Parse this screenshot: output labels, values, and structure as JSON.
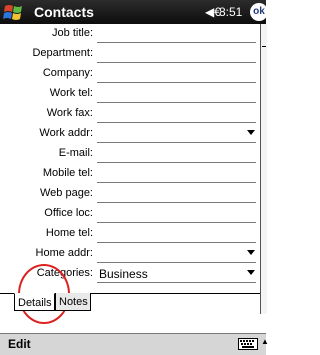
{
  "window": {
    "title": "Contacts",
    "time": "8:51",
    "ok_label": "ok",
    "speaker_glyph": "◀€"
  },
  "fields": [
    {
      "label": "Job title:",
      "value": "",
      "dropdown": false
    },
    {
      "label": "Department:",
      "value": "",
      "dropdown": false
    },
    {
      "label": "Company:",
      "value": "",
      "dropdown": false
    },
    {
      "label": "Work tel:",
      "value": "",
      "dropdown": false
    },
    {
      "label": "Work fax:",
      "value": "",
      "dropdown": false
    },
    {
      "label": "Work addr:",
      "value": "",
      "dropdown": true
    },
    {
      "label": "E-mail:",
      "value": "",
      "dropdown": false
    },
    {
      "label": "Mobile tel:",
      "value": "",
      "dropdown": false
    },
    {
      "label": "Web page:",
      "value": "",
      "dropdown": false
    },
    {
      "label": "Office loc:",
      "value": "",
      "dropdown": false
    },
    {
      "label": "Home tel:",
      "value": "",
      "dropdown": false
    },
    {
      "label": "Home addr:",
      "value": "",
      "dropdown": true
    },
    {
      "label": "Categories:",
      "value": "Business",
      "dropdown": true
    }
  ],
  "tabs": {
    "details": "Details",
    "notes": "Notes"
  },
  "cmdbar": {
    "edit_label": "Edit"
  },
  "colors": {
    "title_bg": "#111111",
    "highlight_ring": "#dd2222"
  },
  "icons": {
    "logo": "windows-flag-icon",
    "keyboard": "keyboard-icon"
  }
}
